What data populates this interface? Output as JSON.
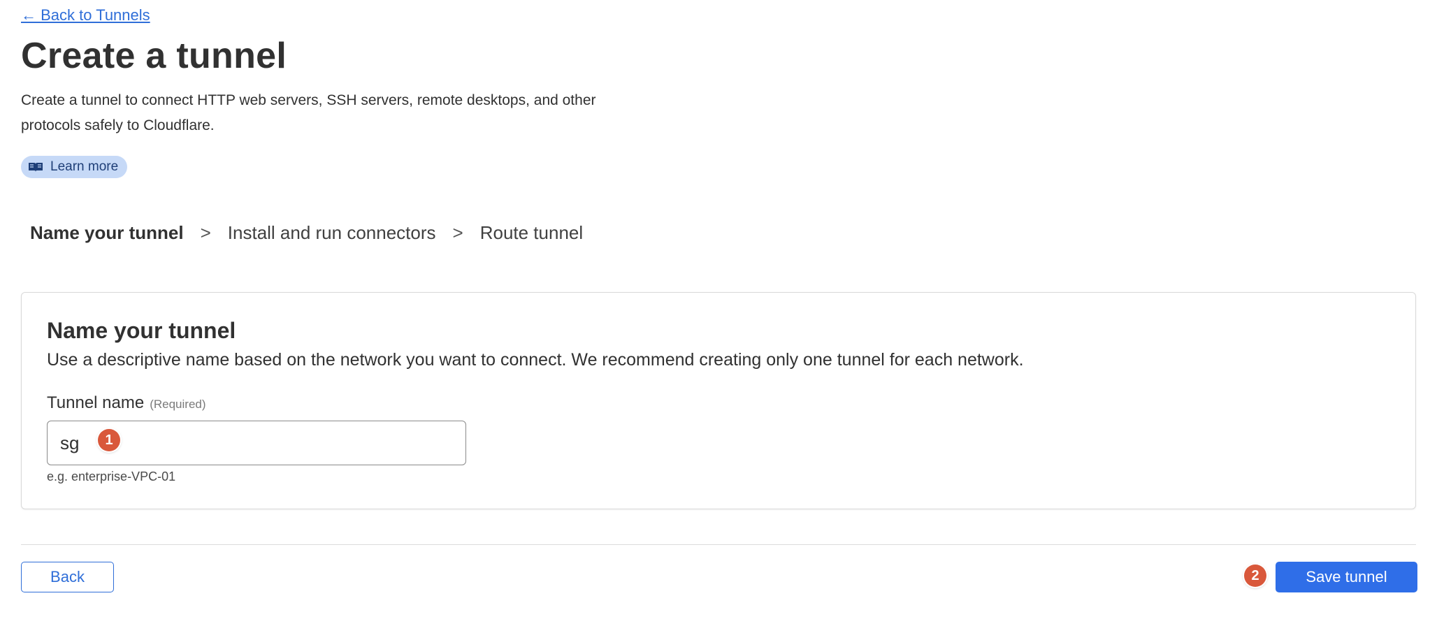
{
  "nav": {
    "back_link": "← Back to Tunnels"
  },
  "page": {
    "title": "Create a tunnel",
    "description_line1": "Create a tunnel to connect HTTP web servers, SSH servers, remote desktops, and other",
    "description_line2": "protocols safely to Cloudflare.",
    "learn_more": "Learn more",
    "learn_more_icon": "book-icon"
  },
  "stepper": {
    "steps": [
      "Name your tunnel",
      "Install and run connectors",
      "Route tunnel"
    ],
    "separator": ">",
    "active_index": 0
  },
  "card": {
    "title": "Name your tunnel",
    "description": "Use a descriptive name based on the network you want to connect. We recommend creating only one tunnel for each network.",
    "field_label": "Tunnel name",
    "field_required": "(Required)",
    "field_value": "sg",
    "field_hint": "e.g. enterprise-VPC-01"
  },
  "markers": [
    "1",
    "2"
  ],
  "footer": {
    "back_label": "Back",
    "save_label": "Save tunnel"
  },
  "colors": {
    "accent": "#2f6ee8",
    "marker": "#d9583b",
    "pill_bg": "#c6d9f7"
  }
}
